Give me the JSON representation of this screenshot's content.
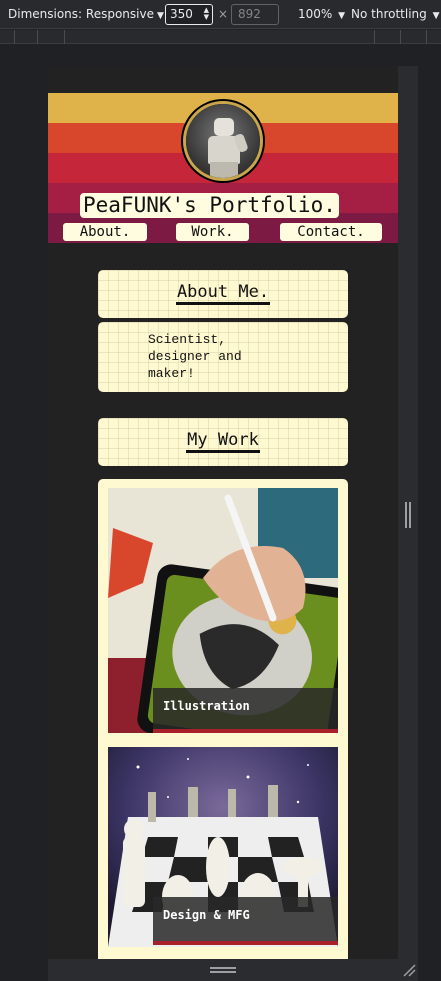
{
  "devtools": {
    "dimensions_label": "Dimensions: Responsive",
    "width": "350",
    "times": "×",
    "height_placeholder": "892",
    "zoom": "100%",
    "throttling": "No throttling"
  },
  "site": {
    "title": "PeaFUNK's Portfolio.",
    "nav": [
      "About.",
      "Work.",
      "Contact."
    ],
    "stripe_colors": [
      "#e0b24a",
      "#d8472b",
      "#c6263a",
      "#a51f45",
      "#7c1a44"
    ],
    "accent": "#fff9d2"
  },
  "about": {
    "heading": "About Me.",
    "text": "Scientist, designer and maker!"
  },
  "work": {
    "heading": "My Work",
    "tiles": [
      {
        "label": "Illustration"
      },
      {
        "label": "Design & MFG"
      }
    ]
  }
}
